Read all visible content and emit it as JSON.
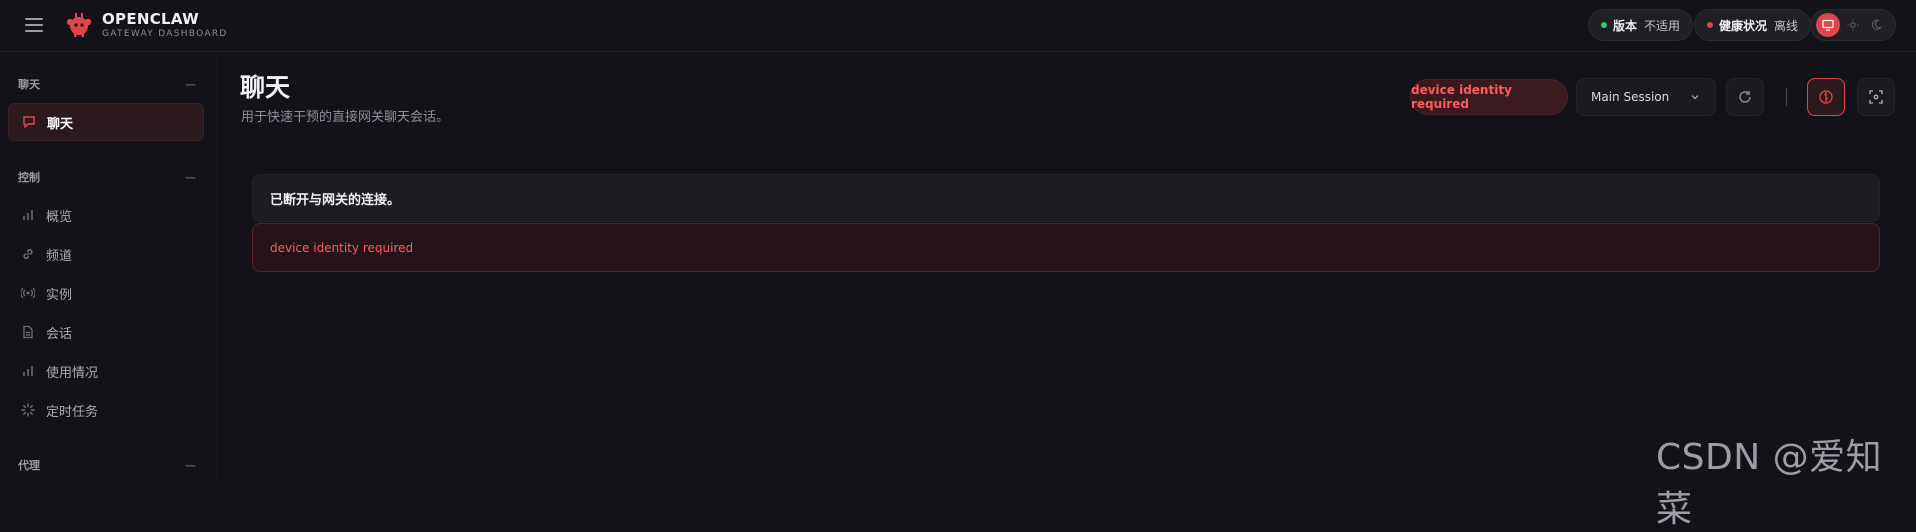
{
  "brand": {
    "title": "OPENCLAW",
    "subtitle": "GATEWAY DASHBOARD"
  },
  "header": {
    "version": {
      "label": "版本",
      "value": "不适用",
      "dot_color": "#2ecc71"
    },
    "health": {
      "label": "健康状况",
      "value": "离线",
      "dot_color": "#e0454b"
    },
    "theme_modes": [
      "system-icon",
      "sun-icon",
      "moon-icon"
    ],
    "active_theme": "system"
  },
  "sidebar": {
    "sections": [
      {
        "title": "聊天",
        "items": [
          {
            "label": "聊天",
            "icon": "chat-bubble-icon",
            "active": true
          }
        ]
      },
      {
        "title": "控制",
        "items": [
          {
            "label": "概览",
            "icon": "bar-chart-icon"
          },
          {
            "label": "频道",
            "icon": "link-icon"
          },
          {
            "label": "实例",
            "icon": "radio-icon"
          },
          {
            "label": "会话",
            "icon": "document-icon"
          },
          {
            "label": "使用情况",
            "icon": "bar-chart-icon"
          },
          {
            "label": "定时任务",
            "icon": "loader-icon"
          }
        ]
      },
      {
        "title": "代理",
        "items": []
      }
    ]
  },
  "main": {
    "title": "聊天",
    "subtitle": "用于快速干预的直接网关聊天会话。",
    "error_chip": "device identity required",
    "session_select": "Main Session",
    "status_message": "已断开与网关的连接。",
    "error_message": "device identity required"
  },
  "watermark": "CSDN @爱知菜",
  "colors": {
    "accent": "#e0454b",
    "error_text": "#ff5a5f",
    "background": "#121218"
  }
}
